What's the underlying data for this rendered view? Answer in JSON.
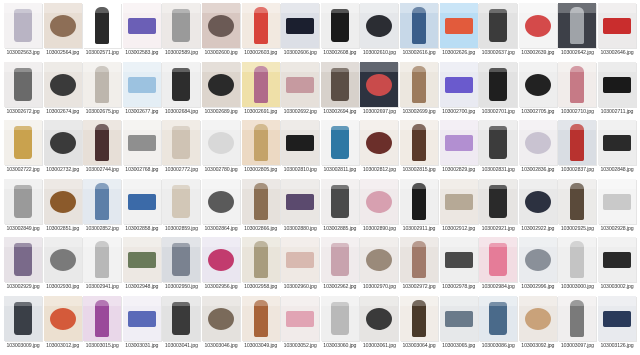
{
  "thumbnail_icon": "image-file-thumbnail",
  "rows": [
    {
      "files": [
        {
          "name": "103002563.jpg",
          "bg": "#f3f1f2",
          "fg": "#b9b4c4"
        },
        {
          "name": "103002564.jpg",
          "bg": "#e7ddd3",
          "fg": "#8d6e56"
        },
        {
          "name": "103002571.jpg",
          "bg": "#ffffff",
          "fg": "#2a2a2a"
        },
        {
          "name": "103002583.jpg",
          "bg": "#f7f0f2",
          "fg": "#6b5fb6"
        },
        {
          "name": "103002589.jpg",
          "bg": "#ece8e6",
          "fg": "#9a9a9a"
        },
        {
          "name": "103002600.jpg",
          "bg": "#d8c7c1",
          "fg": "#6b5a55"
        },
        {
          "name": "103002603.jpg",
          "bg": "#f2e9e0",
          "fg": "#d8443b"
        },
        {
          "name": "103002606.jpg",
          "bg": "#dcdfe6",
          "fg": "#1b1f2f"
        },
        {
          "name": "103002608.jpg",
          "bg": "#eeeeee",
          "fg": "#1a1a1a"
        },
        {
          "name": "103002610.jpg",
          "bg": "#e5e7ea",
          "fg": "#2b2d33"
        },
        {
          "name": "103002616.jpg",
          "bg": "#c7d8e8",
          "fg": "#3a5e8a"
        },
        {
          "name": "103002626.jpg",
          "bg": "#b9ddf4",
          "fg": "#e25b3c"
        },
        {
          "name": "103002637.jpg",
          "bg": "#e2e2e2",
          "fg": "#3b3b3b"
        },
        {
          "name": "103002639.jpg",
          "bg": "#f4f4f4",
          "fg": "#d44a4a"
        },
        {
          "name": "103002642.jpg",
          "bg": "#3d4048",
          "fg": "#9fa3a8"
        },
        {
          "name": "103002646.jpg",
          "bg": "#eceaea",
          "fg": "#c92d2d"
        }
      ]
    },
    {
      "files": [
        {
          "name": "103002672.jpg",
          "bg": "#eceaea",
          "fg": "#6a6a6a"
        },
        {
          "name": "103002674.jpg",
          "bg": "#e9e4df",
          "fg": "#3a3a3a"
        },
        {
          "name": "103002675.jpg",
          "bg": "#f1eeea",
          "fg": "#bdb6ad"
        },
        {
          "name": "103002677.jpg",
          "bg": "#e4eef5",
          "fg": "#9cc2e0"
        },
        {
          "name": "103002684.jpg",
          "bg": "#eeeeee",
          "fg": "#2d2d2d"
        },
        {
          "name": "103002689.jpg",
          "bg": "#ddd5cd",
          "fg": "#2a2a2a"
        },
        {
          "name": "103002691.jpg",
          "bg": "#efe0a8",
          "fg": "#b06a8a"
        },
        {
          "name": "103002692.jpg",
          "bg": "#e6e0da",
          "fg": "#c69aa0"
        },
        {
          "name": "103002694.jpg",
          "bg": "#d7d1cb",
          "fg": "#5b4e45"
        },
        {
          "name": "103002697.jpg",
          "bg": "#2d3340",
          "fg": "#c94b4b"
        },
        {
          "name": "103002699.jpg",
          "bg": "#ece7df",
          "fg": "#9c7b5d"
        },
        {
          "name": "103002700.jpg",
          "bg": "#e9eaf2",
          "fg": "#6a5acd"
        },
        {
          "name": "103002701.jpg",
          "bg": "#e2e2e2",
          "fg": "#1f1f1f"
        },
        {
          "name": "103002705.jpg",
          "bg": "#eeeeee",
          "fg": "#222222"
        },
        {
          "name": "103002710.jpg",
          "bg": "#f1ecea",
          "fg": "#c67a86"
        },
        {
          "name": "103002711.jpg",
          "bg": "#e6e6e6",
          "fg": "#1a1a1a"
        }
      ]
    },
    {
      "files": [
        {
          "name": "103002722.jpg",
          "bg": "#f2efea",
          "fg": "#c9a24e"
        },
        {
          "name": "103002732.jpg",
          "bg": "#e2e2e2",
          "fg": "#3a3a3a"
        },
        {
          "name": "103002744.jpg",
          "bg": "#e7dfd7",
          "fg": "#4a2f2f"
        },
        {
          "name": "103002768.jpg",
          "bg": "#f2f0ee",
          "fg": "#8f8f8f"
        },
        {
          "name": "103002772.jpg",
          "bg": "#ece6de",
          "fg": "#cfc3b4"
        },
        {
          "name": "103002780.jpg",
          "bg": "#efefef",
          "fg": "#d8d8d8"
        },
        {
          "name": "103002805.jpg",
          "bg": "#ecd9c3",
          "fg": "#c4a36a"
        },
        {
          "name": "103002810.jpg",
          "bg": "#e8e4e0",
          "fg": "#1e1e1e"
        },
        {
          "name": "103002811.jpg",
          "bg": "#f2f2f2",
          "fg": "#2e78a4"
        },
        {
          "name": "103002812.jpg",
          "bg": "#f0ebe6",
          "fg": "#6b2f2a"
        },
        {
          "name": "103002815.jpg",
          "bg": "#f1ebe4",
          "fg": "#5a3a2a"
        },
        {
          "name": "103002829.jpg",
          "bg": "#efeaf2",
          "fg": "#b28fd1"
        },
        {
          "name": "103002831.jpg",
          "bg": "#e8e8e8",
          "fg": "#3c3c3c"
        },
        {
          "name": "103002836.jpg",
          "bg": "#f0eef0",
          "fg": "#c9c3d1"
        },
        {
          "name": "103002837.jpg",
          "bg": "#d9dde3",
          "fg": "#b8322f"
        },
        {
          "name": "103002848.jpg",
          "bg": "#ededed",
          "fg": "#2a2a2a"
        }
      ]
    },
    {
      "files": [
        {
          "name": "103002849.jpg",
          "bg": "#ececec",
          "fg": "#9a9a9a"
        },
        {
          "name": "103002851.jpg",
          "bg": "#e7e2dd",
          "fg": "#8b5a2b"
        },
        {
          "name": "103002852.jpg",
          "bg": "#e2e8ef",
          "fg": "#5d7fa8"
        },
        {
          "name": "103002858.jpg",
          "bg": "#f1f1f1",
          "fg": "#3b6aa8"
        },
        {
          "name": "103002859.jpg",
          "bg": "#ededed",
          "fg": "#d2c7b7"
        },
        {
          "name": "103002864.jpg",
          "bg": "#f2f2f2",
          "fg": "#5a5a5a"
        },
        {
          "name": "103002866.jpg",
          "bg": "#e6e1dc",
          "fg": "#8a6e52"
        },
        {
          "name": "103002880.jpg",
          "bg": "#e9e6e3",
          "fg": "#5b4a6e"
        },
        {
          "name": "103002885.jpg",
          "bg": "#efeded",
          "fg": "#4a4a4a"
        },
        {
          "name": "103002890.jpg",
          "bg": "#f0eaeb",
          "fg": "#d7a0b0"
        },
        {
          "name": "103002911.jpg",
          "bg": "#efefef",
          "fg": "#1b1b1b"
        },
        {
          "name": "103002912.jpg",
          "bg": "#ece7e2",
          "fg": "#b6a996"
        },
        {
          "name": "103002921.jpg",
          "bg": "#e6e4e2",
          "fg": "#2a2a2a"
        },
        {
          "name": "103002922.jpg",
          "bg": "#e8e8e8",
          "fg": "#2c3140"
        },
        {
          "name": "103002925.jpg",
          "bg": "#ebeae8",
          "fg": "#5a4a3a"
        },
        {
          "name": "103002928.jpg",
          "bg": "#f4f4f4",
          "fg": "#c9c9c9"
        }
      ]
    },
    {
      "files": [
        {
          "name": "103002929.jpg",
          "bg": "#e6e1e6",
          "fg": "#7a6a8a"
        },
        {
          "name": "103002930.jpg",
          "bg": "#e9e9e9",
          "fg": "#7a7a7a"
        },
        {
          "name": "103002941.jpg",
          "bg": "#f2f2f2",
          "fg": "#b8b8b8"
        },
        {
          "name": "103002948.jpg",
          "bg": "#ede8e3",
          "fg": "#6a7a5a"
        },
        {
          "name": "103002950.jpg",
          "bg": "#d8dbe0",
          "fg": "#7a8290"
        },
        {
          "name": "103002956.jpg",
          "bg": "#eae6f0",
          "fg": "#c23b6e"
        },
        {
          "name": "103002958.jpg",
          "bg": "#e9e4da",
          "fg": "#a89c7e"
        },
        {
          "name": "103002960.jpg",
          "bg": "#efe9e4",
          "fg": "#d8b9b0"
        },
        {
          "name": "103002962.jpg",
          "bg": "#f0ebec",
          "fg": "#c8a3ae"
        },
        {
          "name": "103002970.jpg",
          "bg": "#ece8e6",
          "fg": "#9a8a7a"
        },
        {
          "name": "103002972.jpg",
          "bg": "#e8e3df",
          "fg": "#a07a6a"
        },
        {
          "name": "103002978.jpg",
          "bg": "#eeeeee",
          "fg": "#4a4a4a"
        },
        {
          "name": "103002984.jpg",
          "bg": "#f2dde3",
          "fg": "#e57c98"
        },
        {
          "name": "103002996.jpg",
          "bg": "#e9ebee",
          "fg": "#8a9099"
        },
        {
          "name": "103003000.jpg",
          "bg": "#efefef",
          "fg": "#c4c4c4"
        },
        {
          "name": "103003002.jpg",
          "bg": "#eeeeee",
          "fg": "#2a2a2a"
        }
      ]
    },
    {
      "files": [
        {
          "name": "103003009.jpg",
          "bg": "#dfe2e6",
          "fg": "#3a3f47"
        },
        {
          "name": "103003012.jpg",
          "bg": "#ece0d0",
          "fg": "#d45a3a"
        },
        {
          "name": "103003015.jpg",
          "bg": "#e9d7e9",
          "fg": "#9a4a9a"
        },
        {
          "name": "103003031.jpg",
          "bg": "#f0eef5",
          "fg": "#5a6ab8"
        },
        {
          "name": "103003041.jpg",
          "bg": "#e2e2e2",
          "fg": "#3a3a3a"
        },
        {
          "name": "103003046.jpg",
          "bg": "#e4e1dd",
          "fg": "#7a6a5a"
        },
        {
          "name": "103003049.jpg",
          "bg": "#efe6dd",
          "fg": "#a8643a"
        },
        {
          "name": "103003052.jpg",
          "bg": "#f1ebea",
          "fg": "#e1a4b4"
        },
        {
          "name": "103003060.jpg",
          "bg": "#efefef",
          "fg": "#b9b9b9"
        },
        {
          "name": "103003061.jpg",
          "bg": "#e6e4e2",
          "fg": "#3a3a3a"
        },
        {
          "name": "103003064.jpg",
          "bg": "#f1ece7",
          "fg": "#4a3a2a"
        },
        {
          "name": "103003065.jpg",
          "bg": "#e6e8ea",
          "fg": "#6a7a8a"
        },
        {
          "name": "103003086.jpg",
          "bg": "#e2e8ee",
          "fg": "#4a6a8a"
        },
        {
          "name": "103003092.jpg",
          "bg": "#ece7e2",
          "fg": "#c9a27a"
        },
        {
          "name": "103003097.jpg",
          "bg": "#f0eeee",
          "fg": "#7a7a7a"
        },
        {
          "name": "103003126.jpg",
          "bg": "#e8eaee",
          "fg": "#2a3a5a"
        }
      ]
    }
  ]
}
